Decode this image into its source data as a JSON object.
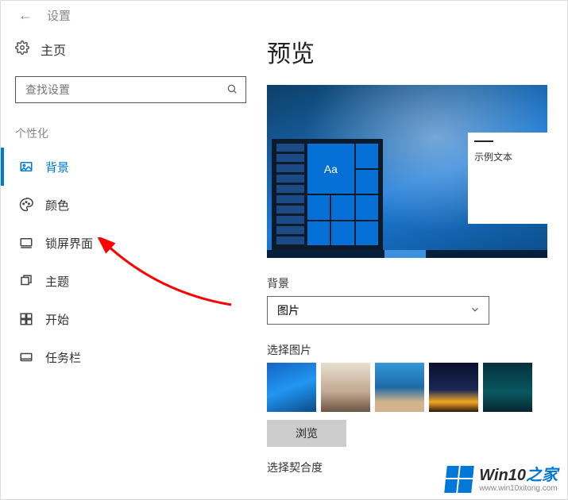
{
  "titlebar": {
    "label": "设置"
  },
  "sidebar": {
    "home": "主页",
    "search_placeholder": "查找设置",
    "section": "个性化",
    "items": [
      {
        "label": "背景"
      },
      {
        "label": "颜色"
      },
      {
        "label": "锁屏界面"
      },
      {
        "label": "主题"
      },
      {
        "label": "开始"
      },
      {
        "label": "任务栏"
      }
    ]
  },
  "main": {
    "heading": "预览",
    "sample_text": "示例文本",
    "sample_aa": "Aa",
    "bg_label": "背景",
    "bg_value": "图片",
    "choose_label": "选择图片",
    "browse": "浏览",
    "cutoff": "选择契合度"
  },
  "watermark": {
    "brand_a": "Win10",
    "brand_b": "之家",
    "url": "www.win10xitong.com"
  }
}
